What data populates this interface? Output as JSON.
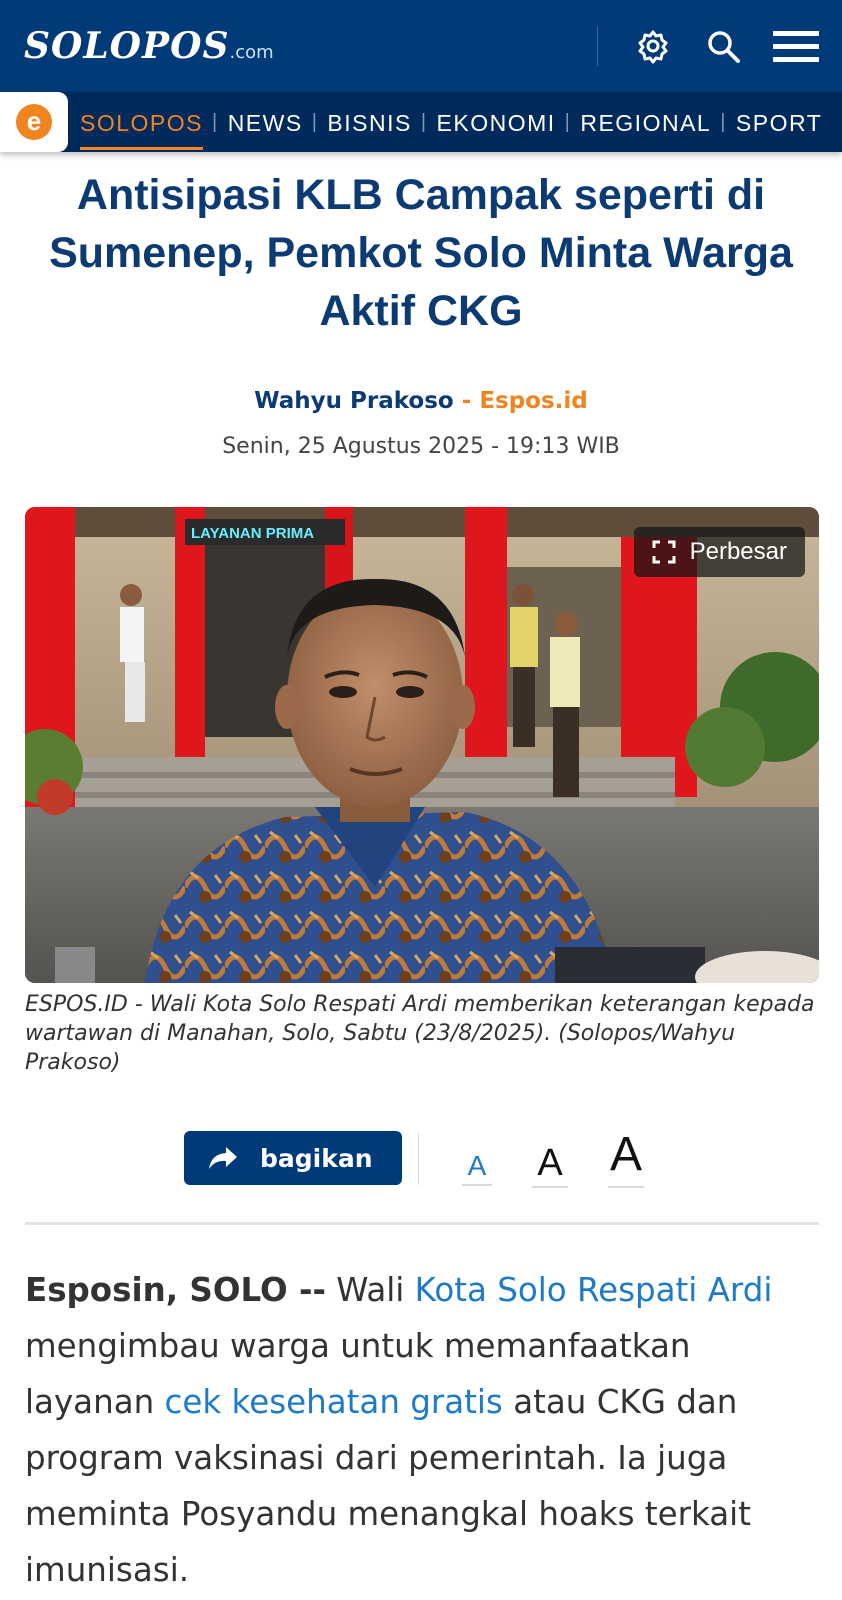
{
  "header": {
    "logo_text": "SOLOPOS",
    "logo_suffix": ".com",
    "icons": [
      "gear-icon",
      "search-icon",
      "menu-icon"
    ],
    "colors": {
      "primary": "#003a78",
      "nav": "#002a5c",
      "accent": "#f08520"
    }
  },
  "nav": {
    "badge_letter": "e",
    "items": [
      {
        "label": "SOLOPOS",
        "active": true
      },
      {
        "label": "NEWS"
      },
      {
        "label": "BISNIS"
      },
      {
        "label": "EKONOMI"
      },
      {
        "label": "REGIONAL"
      },
      {
        "label": "SPORT"
      }
    ],
    "separator": "|"
  },
  "article": {
    "title": "Antisipasi KLB Campak seperti di Sumenep, Pemkot Solo Minta Warga Aktif CKG",
    "author": "Wahyu Prakoso",
    "byline_separator": "-",
    "source": "Espos.id",
    "date": "Senin, 25 Agustus 2025 - 19:13 WIB",
    "photo": {
      "enlarge_label": "Perbesar",
      "sign_text": "LAYANAN PRIMA",
      "caption": "ESPOS.ID - Wali Kota Solo Respati Ardi memberikan keterangan kepada wartawan di Manahan, Solo, Sabtu (23/8/2025). (Solopos/Wahyu Prakoso)"
    },
    "tools": {
      "share_label": "bagikan",
      "font_small": "A",
      "font_medium": "A",
      "font_large": "A"
    },
    "body": {
      "lead": "Esposin, SOLO --",
      "t1": " Wali ",
      "link1": "Kota Solo Respati Ardi",
      "t2": " mengimbau warga untuk memanfaatkan layanan ",
      "link2": "cek kesehatan gratis",
      "t3": " atau CKG dan program vaksinasi dari pemerintah. Ia juga meminta Posyandu menangkal hoaks terkait imunisasi."
    }
  }
}
